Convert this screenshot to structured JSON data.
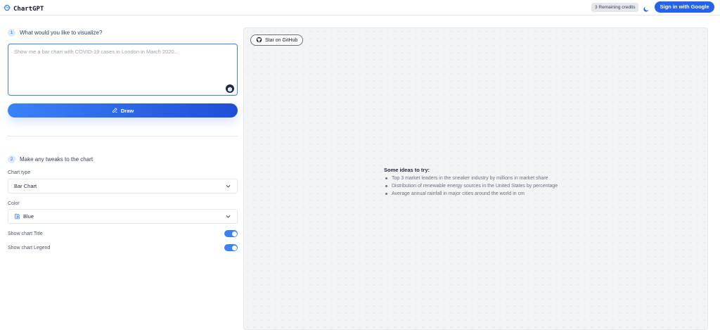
{
  "header": {
    "app_name": "ChartGPT",
    "credits": "3 Remaining credits",
    "signin_label": "Sign in with Google"
  },
  "step1": {
    "number": "1",
    "title": "What would you like to visualize?",
    "prompt_value": "",
    "prompt_placeholder": "Show me a bar chart with COVID-19 cases in London in March 2020...",
    "draw_label": "Draw"
  },
  "step2": {
    "number": "2",
    "title": "Make any tweaks to the chart",
    "chart_type_label": "Chart type",
    "chart_type_value": "Bar Chart",
    "color_label": "Color",
    "color_value": "Blue",
    "show_title_label": "Show chart Title",
    "show_title_on": true,
    "show_legend_label": "Show chart Legend",
    "show_legend_on": true
  },
  "canvas": {
    "github_label": "Star on GitHub",
    "ideas_title": "Some ideas to try:",
    "ideas": [
      "Top 3 market leaders in the sneaker industry by millions in market share",
      "Distribution of renewable energy sources in the United States by percentage",
      "Average annual rainfall in major cities around the world in cm"
    ]
  },
  "colors": {
    "accent": "#2563eb",
    "canvas_bg": "#f3f4f6"
  },
  "icons": [
    "chartgpt-logo-icon",
    "moon-icon",
    "hexagon-icon",
    "pencil-icon",
    "chevron-down-icon",
    "palette-icon",
    "github-icon"
  ]
}
